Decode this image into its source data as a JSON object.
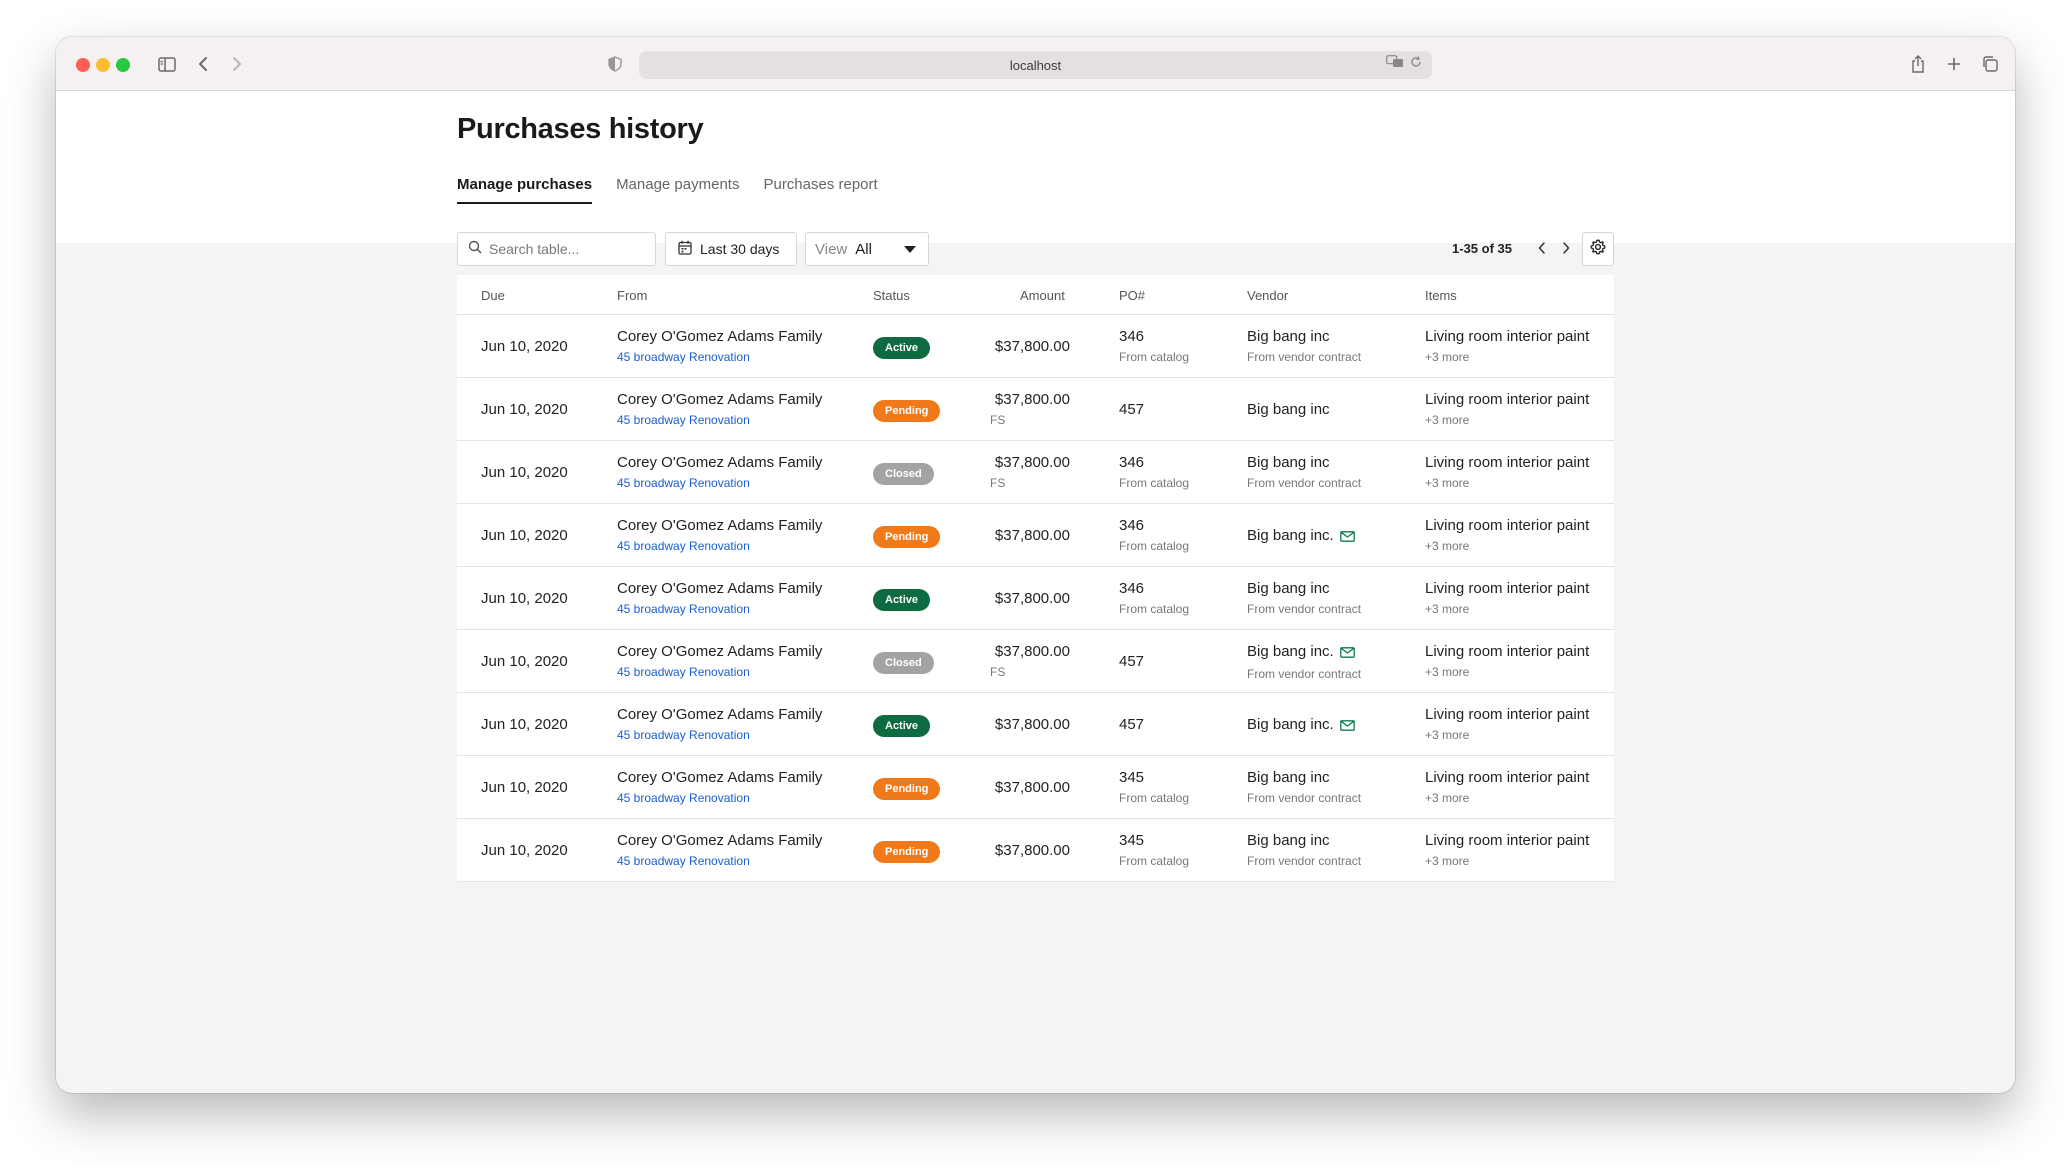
{
  "browser": {
    "url": "localhost"
  },
  "page": {
    "title": "Purchases history",
    "tabs": [
      {
        "label": "Manage purchases",
        "active": true
      },
      {
        "label": "Manage payments",
        "active": false
      },
      {
        "label": "Purchases report",
        "active": false
      }
    ]
  },
  "toolbar": {
    "search_placeholder": "Search table...",
    "date_range": "Last 30 days",
    "view_label": "View",
    "view_value": "All",
    "pagination": "1-35 of 35"
  },
  "table": {
    "headers": {
      "due": "Due",
      "from": "From",
      "status": "Status",
      "amount": "Amount",
      "po": "PO#",
      "vendor": "Vendor",
      "items": "Items"
    },
    "rows": [
      {
        "due": "Jun 10, 2020",
        "from": "Corey O'Gomez Adams Family",
        "project": "45 broadway Renovation",
        "status": "Active",
        "amount": "$37,800.00",
        "amount_note": "",
        "po": "346",
        "po_note": "From catalog",
        "vendor": "Big bang inc",
        "vendor_note": "From vendor contract",
        "vendor_mail": false,
        "items": "Living room interior paint",
        "items_more": "+3 more"
      },
      {
        "due": "Jun 10, 2020",
        "from": "Corey O'Gomez Adams Family",
        "project": "45 broadway Renovation",
        "status": "Pending",
        "amount": "$37,800.00",
        "amount_note": "FS",
        "po": "457",
        "po_note": "",
        "vendor": "Big bang inc",
        "vendor_note": "",
        "vendor_mail": false,
        "items": "Living room interior paint",
        "items_more": "+3 more"
      },
      {
        "due": "Jun 10, 2020",
        "from": "Corey O'Gomez Adams Family",
        "project": "45 broadway Renovation",
        "status": "Closed",
        "amount": "$37,800.00",
        "amount_note": "FS",
        "po": "346",
        "po_note": "From catalog",
        "vendor": "Big bang inc",
        "vendor_note": "From vendor contract",
        "vendor_mail": false,
        "items": "Living room interior paint",
        "items_more": "+3 more"
      },
      {
        "due": "Jun 10, 2020",
        "from": "Corey O'Gomez Adams Family",
        "project": "45 broadway Renovation",
        "status": "Pending",
        "amount": "$37,800.00",
        "amount_note": "",
        "po": "346",
        "po_note": "From catalog",
        "vendor": "Big bang inc.",
        "vendor_note": "",
        "vendor_mail": true,
        "items": "Living room interior paint",
        "items_more": "+3 more"
      },
      {
        "due": "Jun 10, 2020",
        "from": "Corey O'Gomez Adams Family",
        "project": "45 broadway Renovation",
        "status": "Active",
        "amount": "$37,800.00",
        "amount_note": "",
        "po": "346",
        "po_note": "From catalog",
        "vendor": "Big bang inc",
        "vendor_note": "From vendor contract",
        "vendor_mail": false,
        "items": "Living room interior paint",
        "items_more": "+3 more"
      },
      {
        "due": "Jun 10, 2020",
        "from": "Corey O'Gomez Adams Family",
        "project": "45 broadway Renovation",
        "status": "Closed",
        "amount": "$37,800.00",
        "amount_note": "FS",
        "po": "457",
        "po_note": "",
        "vendor": "Big bang inc.",
        "vendor_note": "From vendor contract",
        "vendor_mail": true,
        "items": "Living room interior paint",
        "items_more": "+3 more"
      },
      {
        "due": "Jun 10, 2020",
        "from": "Corey O'Gomez Adams Family",
        "project": "45 broadway Renovation",
        "status": "Active",
        "amount": "$37,800.00",
        "amount_note": "",
        "po": "457",
        "po_note": "",
        "vendor": "Big bang inc.",
        "vendor_note": "",
        "vendor_mail": true,
        "items": "Living room interior paint",
        "items_more": "+3 more"
      },
      {
        "due": "Jun 10, 2020",
        "from": "Corey O'Gomez Adams Family",
        "project": "45 broadway Renovation",
        "status": "Pending",
        "amount": "$37,800.00",
        "amount_note": "",
        "po": "345",
        "po_note": "From catalog",
        "vendor": "Big bang inc",
        "vendor_note": "From vendor contract",
        "vendor_mail": false,
        "items": "Living room interior paint",
        "items_more": "+3 more"
      },
      {
        "due": "Jun 10, 2020",
        "from": "Corey O'Gomez Adams Family",
        "project": "45 broadway Renovation",
        "status": "Pending",
        "amount": "$37,800.00",
        "amount_note": "",
        "po": "345",
        "po_note": "From catalog",
        "vendor": "Big bang inc",
        "vendor_note": "From vendor contract",
        "vendor_mail": false,
        "items": "Living room interior paint",
        "items_more": "+3 more"
      }
    ]
  },
  "colors": {
    "status_active": "#0e6b3f",
    "status_pending": "#f07a1a",
    "status_closed": "#a3a3a3",
    "link": "#1a5fd0"
  },
  "icons": {
    "search": "search-icon",
    "calendar": "calendar-icon",
    "mail": "mail-icon",
    "settings": "gear-icon",
    "prev": "chevron-left-icon",
    "next": "chevron-right-icon"
  }
}
